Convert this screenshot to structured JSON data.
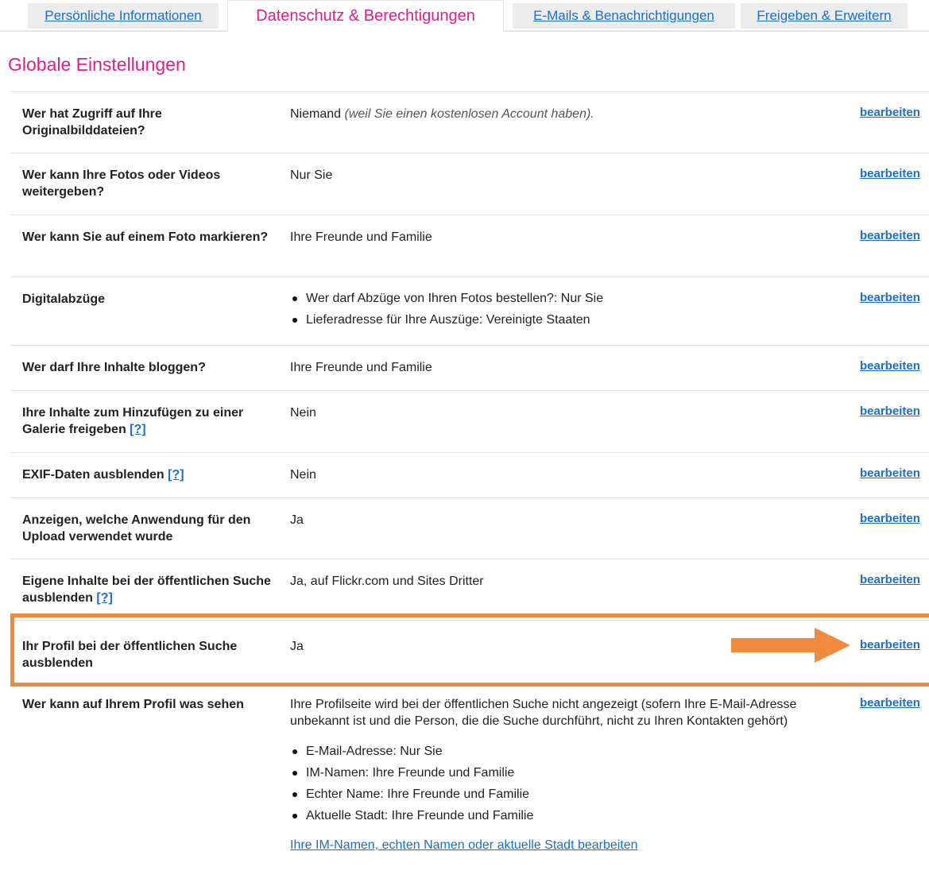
{
  "tabs": [
    {
      "label": "Persönliche Informationen",
      "active": false
    },
    {
      "label": "Datenschutz & Berechtigungen",
      "active": true
    },
    {
      "label": "E-Mails & Benachrichtigungen",
      "active": false
    },
    {
      "label": "Freigeben & Erweitern",
      "active": false
    }
  ],
  "section_title": "Globale Einstellungen",
  "edit_label": "bearbeiten",
  "help_label": "[?]",
  "rows": [
    {
      "label": "Wer hat Zugriff auf Ihre Originalbilddateien?",
      "value": "Niemand",
      "note": "(weil Sie einen kostenlosen Account haben)."
    },
    {
      "label": "Wer kann Ihre Fotos oder Videos weitergeben?",
      "value": "Nur Sie"
    },
    {
      "label": "Wer kann Sie auf einem Foto markieren?",
      "value": "Ihre Freunde und Familie"
    },
    {
      "label": "Digitalabzüge",
      "bullets": [
        "Wer darf Abzüge von Ihren Fotos bestellen?: Nur Sie",
        "Lieferadresse für Ihre Auszüge: Vereinigte Staaten"
      ]
    },
    {
      "label": "Wer darf Ihre Inhalte bloggen?",
      "value": "Ihre Freunde und Familie"
    },
    {
      "label": "Ihre Inhalte zum Hinzufügen zu einer Galerie freigeben",
      "value": "Nein"
    },
    {
      "label": "EXIF-Daten ausblenden",
      "value": "Nein"
    },
    {
      "label": "Anzeigen, welche Anwendung für den Upload verwendet wurde",
      "value": "Ja"
    },
    {
      "label": "Eigene Inhalte bei der öffentlichen Suche ausblenden",
      "value": "Ja, auf Flickr.com und Sites Dritter"
    },
    {
      "label": "Ihr Profil bei der öffentlichen Suche ausblenden",
      "value": "Ja"
    },
    {
      "label": "Wer kann auf Ihrem Profil was sehen",
      "value": "Ihre Profilseite wird bei der öffentlichen Suche nicht angezeigt (sofern Ihre E-Mail-Adresse unbekannt ist und die Person, die die Suche durchführt, nicht zu Ihren Kontakten gehört)",
      "bullets": [
        "E-Mail-Adresse: Nur Sie",
        "IM-Namen: Ihre Freunde und Familie",
        "Echter Name: Ihre Freunde und Familie",
        "Aktuelle Stadt: Ihre Freunde und Familie"
      ],
      "link": "Ihre IM-Namen, echten Namen oder aktuelle Stadt bearbeiten"
    }
  ],
  "colors": {
    "accent_pink": "#e21c8a",
    "link_blue": "#1a6fc9",
    "highlight_orange": "#f08a3c"
  },
  "icons": {
    "pointer_arrow": "arrow-right-icon"
  }
}
